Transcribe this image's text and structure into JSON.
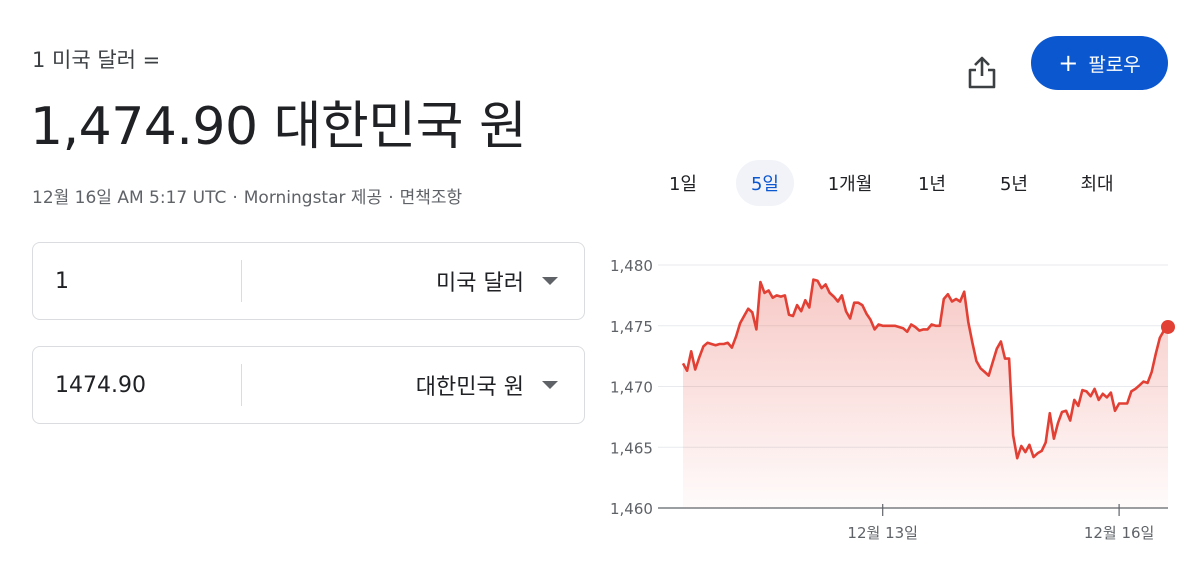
{
  "header": {
    "from_line": "1 미국 달러 =",
    "rate_value": "1,474.90",
    "rate_currency": "대한민국 원",
    "timestamp": "12월 16일 AM 5:17 UTC",
    "source": "Morningstar 제공",
    "disclaimer": "면책조항",
    "separator": "·"
  },
  "actions": {
    "share_icon": "share-icon",
    "follow_label": "팔로우",
    "follow_color": "#0b57d0"
  },
  "converter": {
    "from_amount": "1",
    "from_currency": "미국 달러",
    "to_amount": "1474.90",
    "to_currency": "대한민국 원"
  },
  "range_tabs": [
    {
      "label": "1일",
      "active": false
    },
    {
      "label": "5일",
      "active": true
    },
    {
      "label": "1개월",
      "active": false
    },
    {
      "label": "1년",
      "active": false
    },
    {
      "label": "5년",
      "active": false
    },
    {
      "label": "최대",
      "active": false
    }
  ],
  "chart_data": {
    "type": "area",
    "color": "#e24034",
    "ylim": [
      1460,
      1480
    ],
    "yticks": [
      "1,460",
      "1,465",
      "1,470",
      "1,475",
      "1,480"
    ],
    "ytick_values": [
      1460,
      1465,
      1470,
      1475,
      1480
    ],
    "xticks": [
      {
        "label": "12월 13일",
        "index": 49
      },
      {
        "label": "12월 16일",
        "index": 107
      }
    ],
    "values": [
      1471.9,
      1471.3,
      1472.9,
      1471.4,
      1472.4,
      1473.3,
      1473.6,
      1473.5,
      1473.4,
      1473.5,
      1473.5,
      1473.6,
      1473.2,
      1474.1,
      1475.2,
      1475.8,
      1476.4,
      1476.1,
      1474.7,
      1478.6,
      1477.7,
      1477.9,
      1477.3,
      1477.5,
      1477.4,
      1477.5,
      1475.9,
      1475.8,
      1476.7,
      1476.2,
      1477.1,
      1476.5,
      1478.8,
      1478.7,
      1478.1,
      1478.4,
      1477.7,
      1477.4,
      1477.0,
      1477.5,
      1476.2,
      1475.6,
      1476.9,
      1476.9,
      1476.7,
      1476.0,
      1475.5,
      1474.7,
      1475.1,
      1475.0,
      1475.0,
      1475.0,
      1475.0,
      1474.9,
      1474.8,
      1474.5,
      1475.1,
      1474.9,
      1474.6,
      1474.7,
      1474.7,
      1475.1,
      1475.0,
      1475.0,
      1477.2,
      1477.6,
      1477.0,
      1477.2,
      1477.0,
      1477.8,
      1475.3,
      1473.6,
      1472.1,
      1471.5,
      1471.2,
      1470.9,
      1472.0,
      1473.1,
      1473.7,
      1472.3,
      1472.3,
      1466.0,
      1464.1,
      1465.1,
      1464.6,
      1465.2,
      1464.2,
      1464.5,
      1464.7,
      1465.4,
      1467.8,
      1465.7,
      1467.0,
      1467.9,
      1468.0,
      1467.2,
      1468.9,
      1468.4,
      1469.7,
      1469.6,
      1469.2,
      1469.8,
      1468.9,
      1469.4,
      1469.1,
      1469.5,
      1468.0,
      1468.6,
      1468.6,
      1468.6,
      1469.6,
      1469.8,
      1470.1,
      1470.4,
      1470.3,
      1471.2,
      1472.7,
      1474.0,
      1474.6,
      1474.9
    ]
  }
}
